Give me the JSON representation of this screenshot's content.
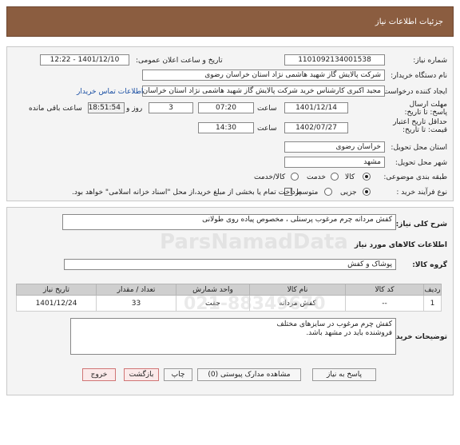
{
  "header": {
    "title": "جزئیات اطلاعات نیاز"
  },
  "fields": {
    "need_number_label": "شماره نیاز:",
    "need_number": "1101092134001538",
    "announce_label": "تاریخ و ساعت اعلان عمومی:",
    "announce_value": "1401/12/10 - 12:22",
    "buyer_org_label": "نام دستگاه خریدار:",
    "buyer_org": "شرکت پالایش گاز شهید هاشمی نژاد   استان خراسان رضوی",
    "creator_label": "ایجاد کننده درخواست:",
    "creator": "مجید اکبری کارشناس خرید شرکت پالایش گاز شهید هاشمی نژاد   استان خراسان رضوی",
    "contact_link": "اطلاعات تماس خریدار",
    "deadline_label": "مهلت ارسال پاسخ: تا تاریخ:",
    "deadline_date": "1401/12/14",
    "time_label": "ساعت",
    "deadline_time": "07:20",
    "days": "3",
    "days_label": "روز و",
    "remaining": "18:51:54",
    "remaining_label": "ساعت باقی مانده",
    "validity_label": "حداقل تاریخ اعتبار قیمت: تا تاریخ:",
    "validity_date": "1402/07/27",
    "validity_time_label": "ساعت",
    "validity_time": "14:30",
    "province_label": "استان محل تحویل:",
    "province": "خراسان رضوی",
    "city_label": "شهر محل تحویل:",
    "city": "مشهد",
    "category_label": "طبقه بندی موضوعی:",
    "category_options": [
      "کالا",
      "خدمت",
      "کالا/خدمت"
    ],
    "process_label": "نوع فرآیند خرید :",
    "process_options": [
      "جزیی",
      "متوسط"
    ],
    "payment_note": "پرداخت تمام یا بخشی از مبلغ خرید،از محل \"اسناد خزانه اسلامی\" خواهد بود."
  },
  "description": {
    "label": "شرح کلی نیاز:",
    "value": "کفش مردانه چرم مرغوب پرسنلی ، مخصوص پیاده روی طولانی"
  },
  "goods": {
    "section_title": "اطلاعات کالاهای مورد نیاز",
    "group_label": "گروه کالا:",
    "group_value": "پوشاک و کفش",
    "headers": [
      "ردیف",
      "کد کالا",
      "نام کالا",
      "واحد شمارش",
      "تعداد / مقدار",
      "تاریخ نیاز"
    ],
    "rows": [
      {
        "row": "1",
        "code": "--",
        "name": "کفش مردانه",
        "unit": "جفت",
        "qty": "33",
        "date": "1401/12/24"
      }
    ]
  },
  "notes": {
    "label": "توضیحات خریدار:",
    "line1": "کفش چرم مرغوب در سایزهای مختلف",
    "line2": "فروشنده باید در مشهد باشد."
  },
  "buttons": {
    "reply": "پاسخ به نیاز",
    "attachments": "مشاهده مدارک پیوستی (0)",
    "print": "چاپ",
    "back": "بازگشت",
    "exit": "خروج"
  },
  "watermark": {
    "brand": "ParsNamadData",
    "phone": "021-88349670"
  },
  "colors": {
    "header_bg": "#8b5d40",
    "link": "#1a4fa3",
    "exit_border": "#d07575"
  }
}
